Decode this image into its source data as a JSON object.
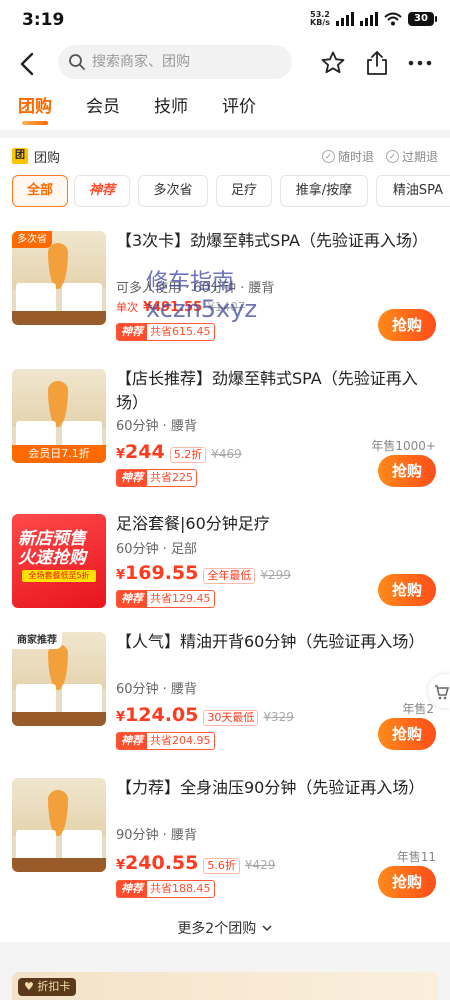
{
  "status_bar": {
    "time": "3:19",
    "net_speed_value": "53.2",
    "net_speed_unit": "KB/s",
    "battery": "30"
  },
  "nav": {
    "search_placeholder": "搜索商家、团购"
  },
  "tabs": [
    {
      "label": "团购",
      "active": true
    },
    {
      "label": "会员",
      "active": false
    },
    {
      "label": "技师",
      "active": false
    },
    {
      "label": "评价",
      "active": false
    }
  ],
  "section": {
    "badge": "团",
    "title": "团购",
    "guarantees": [
      "随时退",
      "过期退"
    ]
  },
  "filters": [
    "全部",
    "神荐",
    "多次省",
    "足疗",
    "推拿/按摩",
    "精油SPA"
  ],
  "items": [
    {
      "tag": "多次省",
      "bottom_tag": "",
      "title": "【3次卡】劲爆至韩式SPA（先验证再入场）",
      "subtitle": "可多人使用 · 60分钟 · 腰背",
      "price_prefix": "单次",
      "price": "491.55",
      "discount": "",
      "original": "¥1407",
      "save_label": "神荐",
      "save": "共省615.45",
      "sold": "",
      "buy": "抢购"
    },
    {
      "tag": "",
      "bottom_tag": "会员日7.1折",
      "title": "【店长推荐】劲爆至韩式SPA（先验证再入场）",
      "subtitle": "60分钟 · 腰背",
      "price_prefix": "",
      "price": "244",
      "discount": "5.2折",
      "original": "¥469",
      "save_label": "神荐",
      "save": "共省225",
      "sold": "年售1000+",
      "buy": "抢购"
    },
    {
      "promo_line1": "新店预售",
      "promo_line2": "火速抢购",
      "promo_small": "全场套餐低至5折",
      "title": "足浴套餐|60分钟足疗",
      "subtitle": "60分钟 · 足部",
      "price": "169.55",
      "discount": "全年最低",
      "original": "¥299",
      "save_label": "神荐",
      "save": "共省129.45",
      "sold": "",
      "buy": "抢购"
    },
    {
      "tag": "商家推荐",
      "bottom_tag": "",
      "title": "【人气】精油开背60分钟（先验证再入场）",
      "subtitle": "60分钟 · 腰背",
      "price": "124.05",
      "discount": "30天最低",
      "original": "¥329",
      "save_label": "神荐",
      "save": "共省204.95",
      "sold": "年售2",
      "buy": "抢购"
    },
    {
      "tag": "",
      "bottom_tag": "",
      "title": "【力荐】全身油压90分钟（先验证再入场）",
      "subtitle": "90分钟 · 腰背",
      "price": "240.55",
      "discount": "5.6折",
      "original": "¥429",
      "save_label": "神荐",
      "save": "共省188.45",
      "sold": "年售11",
      "buy": "抢购"
    }
  ],
  "more_link": "更多2个团购",
  "watermark": {
    "line1": "修车指南",
    "line2": "xczn5xyz"
  },
  "discount_card": {
    "label": "折扣卡"
  },
  "currency": "¥",
  "colors": {
    "accent": "#ff6a00",
    "price": "#ff3b1f"
  }
}
